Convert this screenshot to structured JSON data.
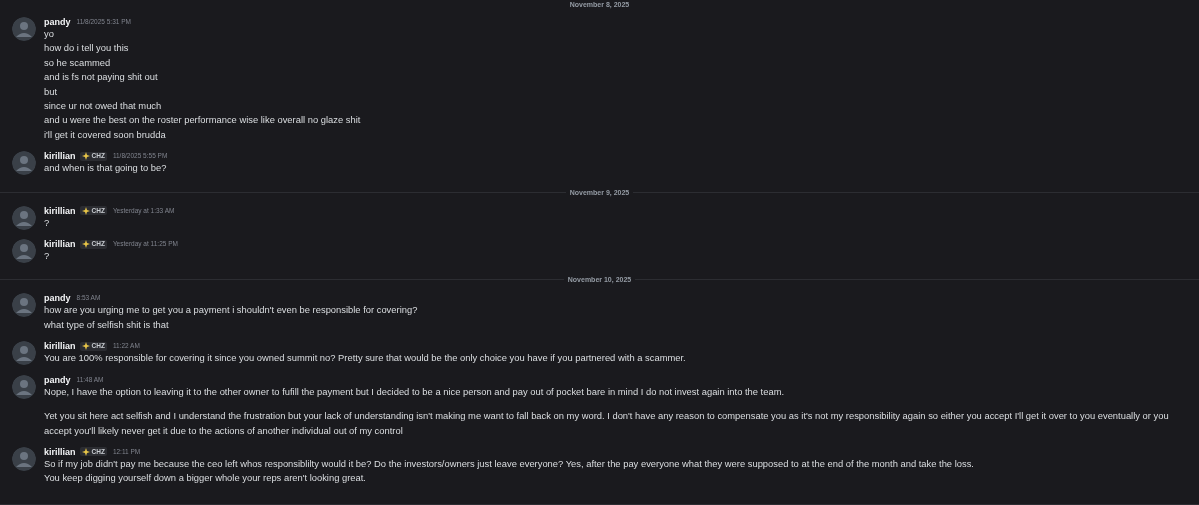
{
  "items": [
    {
      "kind": "divider",
      "label": "November 8, 2025"
    },
    {
      "kind": "message",
      "author": "pandy",
      "time": "11/8/2025 5:31 PM",
      "paragraphs": [
        [
          "yo",
          "how do i tell you this",
          "so he scammed",
          "and is fs not paying shit out",
          "but",
          "since ur not owed that much",
          "and u were the best on the roster performance wise like overall no glaze shit",
          "i'll get it covered soon brudda"
        ]
      ]
    },
    {
      "kind": "message",
      "author": "kirillian",
      "tag": "CHZ",
      "time": "11/8/2025 5:55 PM",
      "paragraphs": [
        [
          "and when is that going to be?"
        ]
      ]
    },
    {
      "kind": "divider",
      "label": "November 9, 2025"
    },
    {
      "kind": "message",
      "author": "kirillian",
      "tag": "CHZ",
      "time": "Yesterday at 1:33 AM",
      "paragraphs": [
        [
          "?"
        ]
      ]
    },
    {
      "kind": "message",
      "author": "kirillian",
      "tag": "CHZ",
      "time": "Yesterday at 11:25 PM",
      "paragraphs": [
        [
          "?"
        ]
      ]
    },
    {
      "kind": "divider",
      "label": "November 10, 2025"
    },
    {
      "kind": "message",
      "author": "pandy",
      "time": "8:53 AM",
      "paragraphs": [
        [
          "how are you urging me to get you a payment i shouldn't even be responsible for covering?",
          "what type of selfish shit is that"
        ]
      ]
    },
    {
      "kind": "message",
      "author": "kirillian",
      "tag": "CHZ",
      "time": "11:22 AM",
      "paragraphs": [
        [
          "You are 100% responsible for covering it since you owned summit no? Pretty sure that would be the only choice you have if you partnered with a scammer."
        ]
      ]
    },
    {
      "kind": "message",
      "author": "pandy",
      "time": "11:48 AM",
      "paragraphs": [
        [
          "Nope, I have the option to leaving it to the other owner to fufill the payment but I decided to be a nice person and pay out of pocket bare in mind I do not invest again into the team."
        ],
        [
          "Yet you sit here act selfish and I understand the frustration but your lack of understanding isn't making me want to fall back on my word. I don't have any reason to compensate you as it's not my responsibility again so either you accept I'll get it over to you eventually or you accept you'll likely never get it due to the actions of another individual out of my control"
        ]
      ]
    },
    {
      "kind": "message",
      "author": "kirillian",
      "tag": "CHZ",
      "time": "12:11 PM",
      "paragraphs": [
        [
          "So if my job didn't pay me because the ceo left whos responsiblilty would it be? Do the investors/owners just leave everyone? Yes, after the pay everyone what they were supposed to at the end of the month and take the loss.",
          "You keep digging yourself down a bigger whole your reps aren't looking great."
        ]
      ]
    }
  ]
}
